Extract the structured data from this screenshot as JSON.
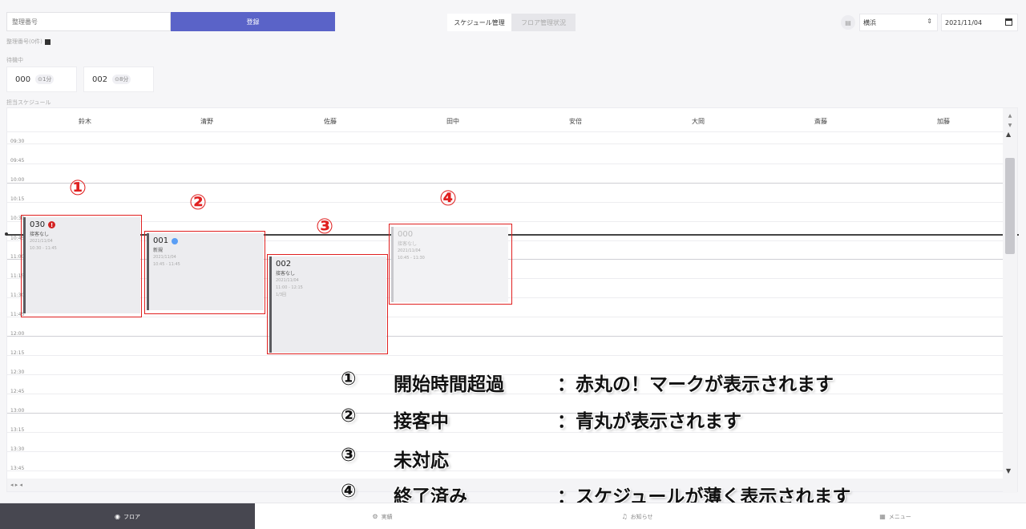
{
  "topbar": {
    "number_placeholder": "整理番号",
    "register_label": "登録",
    "tab_schedule": "スケジュール管理",
    "tab_floor": "フロア管理状況",
    "grid_toggle": "▤",
    "store_select": "横浜",
    "select_arrow": "⇕",
    "date": "2021/11/04"
  },
  "labels": {
    "unprocessed": "整理番号(0件)",
    "waiting": "待機中",
    "schedule": "担当スケジュール"
  },
  "waiting_cards": [
    {
      "num": "000",
      "tag": "⊙1分"
    },
    {
      "num": "002",
      "tag": "⊙8分"
    }
  ],
  "staff": [
    "鈴木",
    "清野",
    "佐藤",
    "田中",
    "安倍",
    "大岡",
    "斎藤",
    "加藤"
  ],
  "times": [
    "09:30",
    "09:45",
    "10:00",
    "10:15",
    "10:30",
    "10:45",
    "11:00",
    "11:15",
    "11:30",
    "11:45",
    "12:00",
    "12:15",
    "12:30",
    "12:45",
    "13:00",
    "13:15",
    "13:30",
    "13:45"
  ],
  "scroll": {
    "up": "▲",
    "down": "▼",
    "hdr_up": "▲",
    "hdr_down": "▼",
    "horizontal": "◂ ▸ ◂"
  },
  "appointments": [
    {
      "num": "030",
      "sub": "接客なし",
      "detail1": "2021/11/04",
      "detail2": "10:30 - 11:45",
      "status": "overdue",
      "badge": "!"
    },
    {
      "num": "001",
      "sub": "新規",
      "detail1": "2021/11/04",
      "detail2": "10:45 - 11:45",
      "status": "serving"
    },
    {
      "num": "002",
      "sub": "接客なし",
      "detail1": "2021/11/04",
      "detail2": "11:00 - 12:15",
      "detail3": "1/3回",
      "status": "pending"
    },
    {
      "num": "000",
      "sub": "接客なし",
      "detail1": "2021/11/04",
      "detail2": "10:45 - 11:30",
      "status": "finished"
    }
  ],
  "markers": [
    "①",
    "②",
    "③",
    "④"
  ],
  "legend": [
    {
      "num": "①",
      "title": "開始時間超過",
      "desc": "：赤丸の！マークが表示されます"
    },
    {
      "num": "②",
      "title": "接客中",
      "desc": "：青丸が表示されます"
    },
    {
      "num": "③",
      "title": "未対応",
      "desc": ""
    },
    {
      "num": "④",
      "title": "終了済み",
      "desc": "：スケジュールが薄く表示されます"
    }
  ],
  "bottom_nav": [
    {
      "icon": "◉",
      "label": "フロア"
    },
    {
      "icon": "⚙",
      "label": "実績"
    },
    {
      "icon": "♫",
      "label": "お知らせ"
    },
    {
      "icon": "▦",
      "label": "メニュー"
    }
  ],
  "colors": {
    "accent": "#5a63c8",
    "overdue": "#d32222",
    "serving": "#5a9ef5",
    "annotation": "#e02020"
  }
}
